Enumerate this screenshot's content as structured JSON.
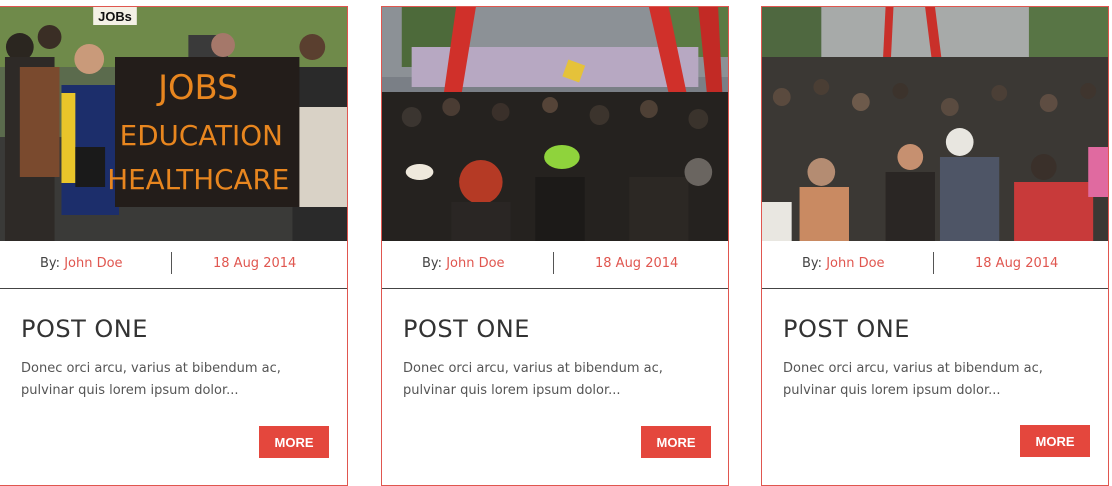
{
  "posts": [
    {
      "by_label": "By: ",
      "author": "John Doe",
      "date": "18 Aug 2014",
      "title": "POST ONE",
      "excerpt": "Donec orci arcu, varius at bibendum ac, pulvinar quis lorem ipsum dolor...",
      "more_label": "MORE",
      "sign_text": [
        "JOBS",
        "EDUCATION",
        "HEALTHCARE"
      ],
      "small_sign": "JOBs"
    },
    {
      "by_label": "By: ",
      "author": "John Doe",
      "date": "18 Aug 2014",
      "title": "POST ONE",
      "excerpt": "Donec orci arcu, varius at bibendum ac, pulvinar quis lorem ipsum dolor...",
      "more_label": "MORE"
    },
    {
      "by_label": "By: ",
      "author": "John Doe",
      "date": "18 Aug 2014",
      "title": "POST ONE",
      "excerpt": "Donec orci arcu, varius at bibendum ac, pulvinar quis lorem ipsum dolor...",
      "more_label": "MORE"
    }
  ],
  "colors": {
    "accent": "#e4473d",
    "border": "#e0564f",
    "text": "#333333"
  }
}
